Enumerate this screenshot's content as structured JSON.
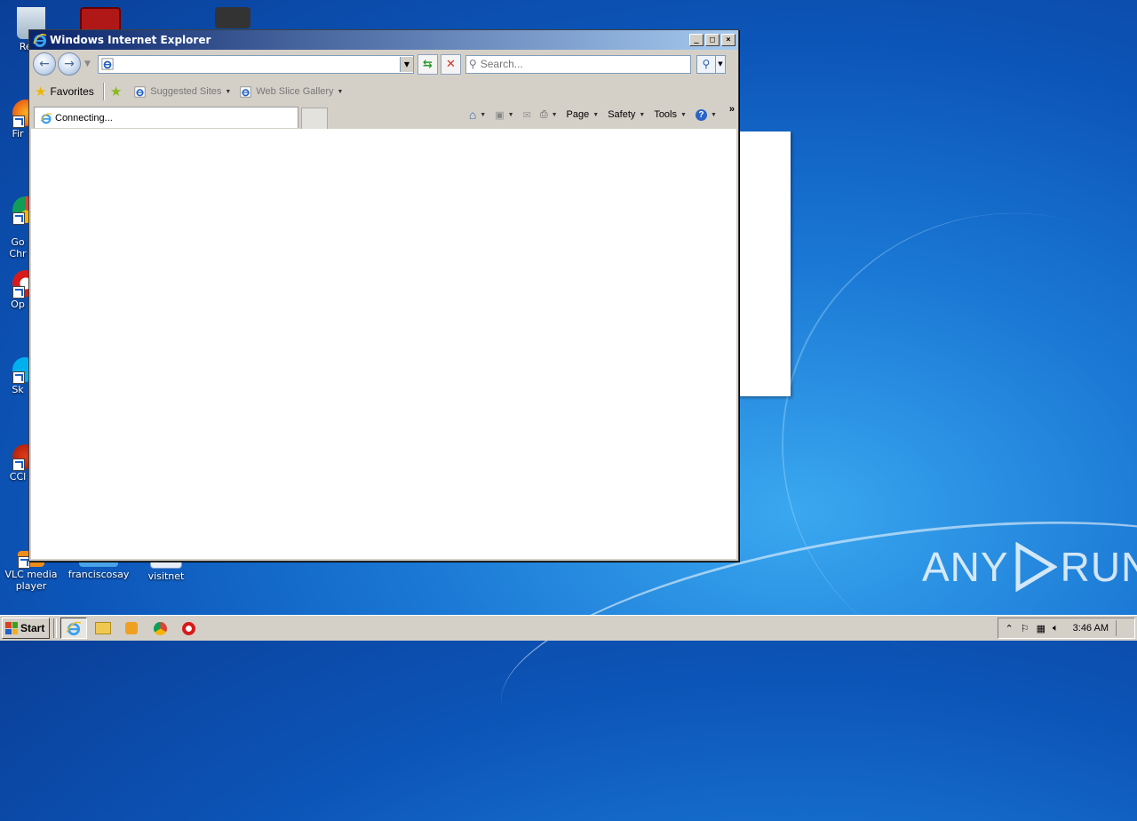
{
  "desktop": {
    "icons": [
      {
        "label": "Recy"
      },
      {
        "label": "Fir"
      },
      {
        "label": "Go\nChr"
      },
      {
        "label": "Op"
      },
      {
        "label": "Sk"
      },
      {
        "label": "CCl"
      },
      {
        "label": "VLC media player"
      },
      {
        "label": "franciscosay"
      },
      {
        "label": "visitnet"
      }
    ],
    "watermark_left": "ANY",
    "watermark_right": "RUN"
  },
  "window": {
    "title": "Windows Internet Explorer",
    "address_value": "",
    "search_placeholder": "Search...",
    "favorites_label": "Favorites",
    "fav_items": [
      "Suggested Sites",
      "Web Slice Gallery"
    ],
    "tab_label": "Connecting...",
    "cmd": {
      "page": "Page",
      "safety": "Safety",
      "tools": "Tools"
    }
  },
  "taskbar": {
    "start_label": "Start",
    "clock": "3:46 AM"
  },
  "colors": {
    "desktop_blue": "#1a77d4",
    "ie_blue": "#1e5fc0",
    "close_red": "#d03020"
  }
}
